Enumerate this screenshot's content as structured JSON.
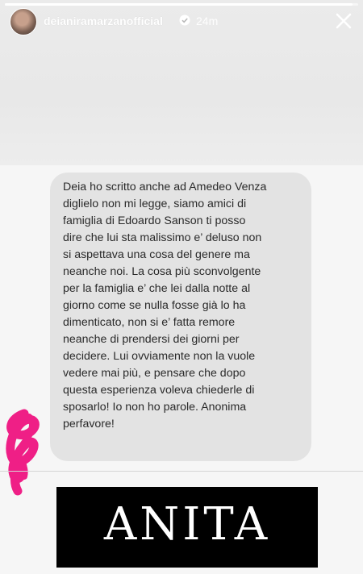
{
  "story": {
    "progress_fraction": 0.985
  },
  "header": {
    "username": "deianiramarzanofficial",
    "timestamp": "24m",
    "avatar_icon": "avatar-photo",
    "verified_icon": "verified-badge-icon",
    "close_icon": "close-icon"
  },
  "message": {
    "text": "Deia ho scritto anche ad Amedeo Venza\ndiglielo non mi legge, siamo amici di\nfamiglia di  Edoardo Sanson ti posso\ndire che lui sta malissimo e’ deluso non\nsi aspettava una cosa del genere ma\nneanche noi. La cosa più sconvolgente\nper la famiglia e’ che lei dalla notte al\ngiorno come se nulla fosse già lo ha\ndimenticato, non si e’ fatta remore\nneanche di prendersi dei giorni per\ndecidere. Lui ovviamente non la vuole\nvedere mai più, e pensare che dopo\nquesta esperienza voleva chiederle di\nsposarlo! Io non ho parole. Anonima\nperfavore!"
  },
  "logo": {
    "text": "ANITA"
  },
  "colors": {
    "bubble": "#e3e3e3",
    "scribble": "#ef1f86",
    "logo_background": "#000000"
  }
}
